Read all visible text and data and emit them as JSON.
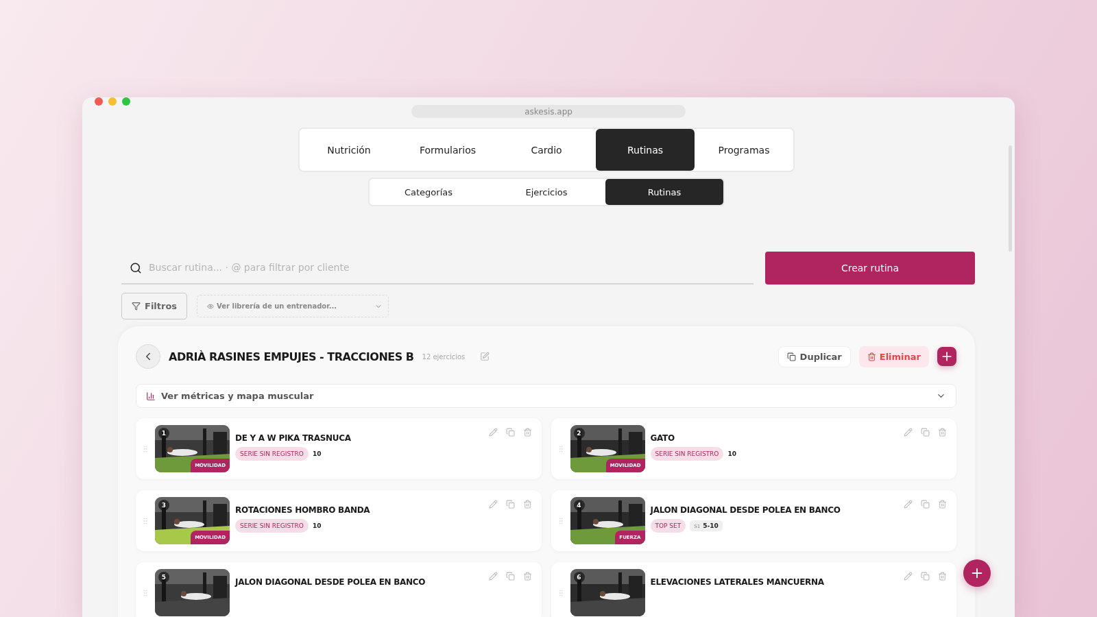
{
  "browser": {
    "url": "askesis.app"
  },
  "main_tabs": [
    {
      "label": "Nutrición",
      "selected": false
    },
    {
      "label": "Formularios",
      "selected": false
    },
    {
      "label": "Cardio",
      "selected": false
    },
    {
      "label": "Rutinas",
      "selected": true
    },
    {
      "label": "Programas",
      "selected": false
    }
  ],
  "sub_tabs": [
    {
      "label": "Categorías",
      "selected": false
    },
    {
      "label": "Ejercicios",
      "selected": false
    },
    {
      "label": "Rutinas",
      "selected": true
    }
  ],
  "search": {
    "placeholder": "Buscar rutina... · @ para filtrar por cliente"
  },
  "create_button": "Crear rutina",
  "filters_button": "Filtros",
  "trainer_select": {
    "placeholder": "Ver librería de un entrenador..."
  },
  "routine": {
    "title": "ADRIÀ RASINES EMPUJES - TRACCIONES B",
    "count": "12 ejercicios",
    "duplicate": "Duplicar",
    "delete": "Eliminar",
    "metrics": "Ver métricas y mapa muscular"
  },
  "exercises": [
    {
      "number": "1",
      "category": "MOVILIDAD",
      "name": "DE Y A W PIKA TRASNUCA",
      "tags": [
        {
          "kind": "type",
          "text": "SERIE SIN REGISTRO"
        },
        {
          "kind": "reps",
          "text": "10"
        }
      ]
    },
    {
      "number": "2",
      "category": "MOVILIDAD",
      "name": "GATO",
      "tags": [
        {
          "kind": "type",
          "text": "SERIE SIN REGISTRO"
        },
        {
          "kind": "reps",
          "text": "10"
        }
      ]
    },
    {
      "number": "3",
      "category": "MOVILIDAD",
      "name": "ROTACIONES HOMBRO BANDA",
      "tags": [
        {
          "kind": "type",
          "text": "SERIE SIN REGISTRO"
        },
        {
          "kind": "reps",
          "text": "10"
        }
      ]
    },
    {
      "number": "4",
      "category": "FUERZA",
      "name": "JALON DIAGONAL DESDE POLEA EN BANCO",
      "tags": [
        {
          "kind": "type",
          "text": "TOP SET"
        },
        {
          "kind": "series",
          "label": "S1",
          "text": "5-10"
        }
      ]
    },
    {
      "number": "5",
      "name": "JALON DIAGONAL DESDE POLEA EN BANCO"
    },
    {
      "number": "6",
      "name": "ELEVACIONES LATERALES MANCUERNA"
    }
  ]
}
